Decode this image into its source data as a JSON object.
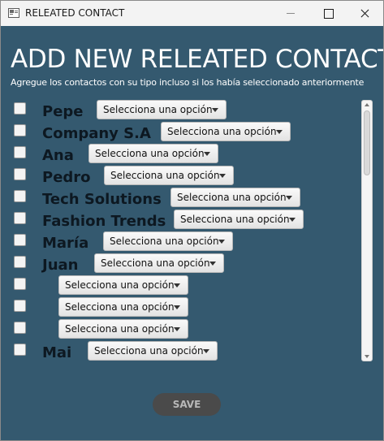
{
  "window": {
    "title": "RELEATED CONTACT",
    "controls": [
      "minimize",
      "maximize",
      "close"
    ]
  },
  "header": {
    "title": "ADD NEW RELEATED CONTACT",
    "subtitle": "Agregue los contactos con su tipo incluso si los había seleccionado anteriormente"
  },
  "contacts": [
    {
      "name": "Pepe",
      "type": "Selecciona una opción",
      "checked": false
    },
    {
      "name": "Company S.A",
      "type": "Selecciona una opción",
      "checked": false
    },
    {
      "name": "Ana",
      "type": "Selecciona una opción",
      "checked": false
    },
    {
      "name": "Pedro",
      "type": "Selecciona una opción",
      "checked": false
    },
    {
      "name": "Tech Solutions",
      "type": "Selecciona una opción",
      "checked": false
    },
    {
      "name": "Fashion Trends",
      "type": "Selecciona una opción",
      "checked": false
    },
    {
      "name": "María",
      "type": "Selecciona una opción",
      "checked": false
    },
    {
      "name": "Juan",
      "type": "Selecciona una opción",
      "checked": false
    },
    {
      "name": "",
      "type": "Selecciona una opción",
      "checked": false
    },
    {
      "name": "",
      "type": "Selecciona una opción",
      "checked": false
    },
    {
      "name": "",
      "type": "Selecciona una opción",
      "checked": false
    },
    {
      "name": "Mai",
      "type": "Selecciona una opción",
      "checked": false
    }
  ],
  "actions": {
    "save_label": "SAVE"
  },
  "colors": {
    "background": "#34596f",
    "name_text": "#0d1821",
    "save_button": "#4a4a4a"
  }
}
